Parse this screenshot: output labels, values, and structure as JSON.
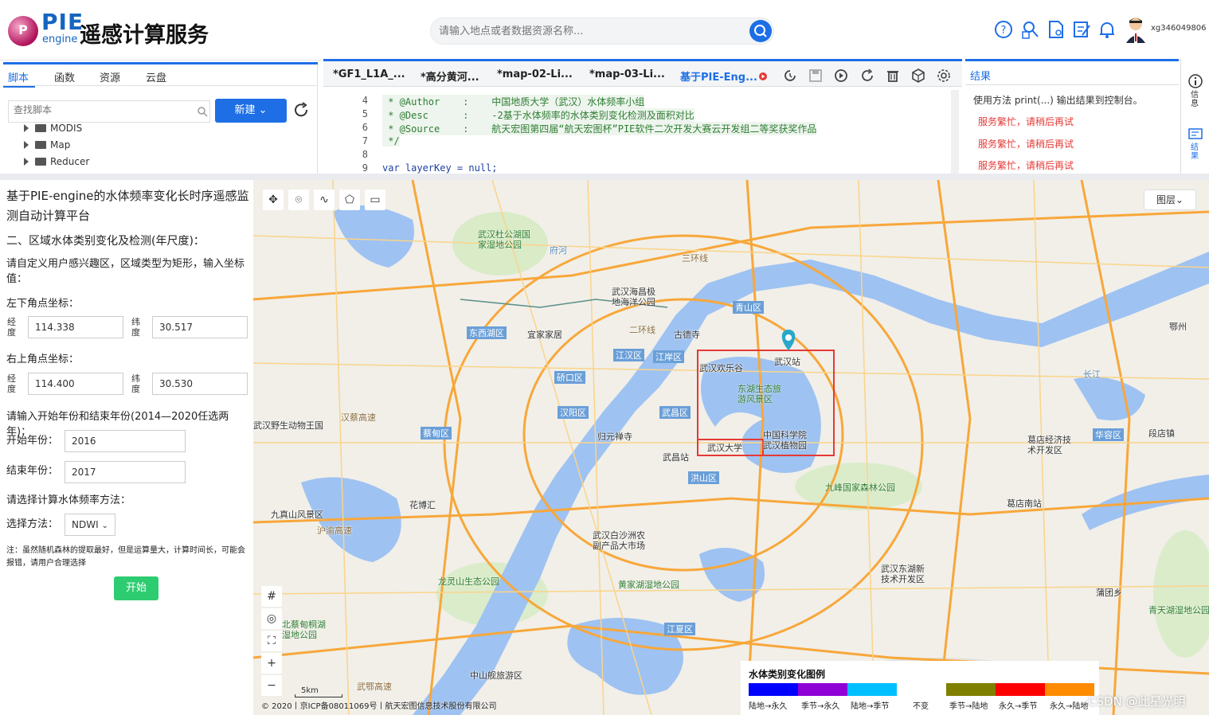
{
  "header": {
    "logo_pie": "PIE",
    "logo_engine": "engine",
    "logo_p": "P",
    "title": "遥感计算服务",
    "search_placeholder": "请输入地点或者数据资源名称...",
    "username": "xg346049806"
  },
  "script_panel": {
    "tabs": [
      "脚本",
      "函数",
      "资源",
      "云盘"
    ],
    "search_placeholder": "查找脚本",
    "new_button": "新建",
    "tree": [
      "MODIS",
      "Map",
      "Reducer"
    ]
  },
  "editor": {
    "tabs": [
      "*GF1_L1A_...",
      "*高分黄河...",
      "*map-02-Li...",
      "*map-03-Li...",
      "基于PIE-Eng..."
    ],
    "lines": [
      {
        "n": "4",
        "text": " * @Author    :    中国地质大学（武汉）水体频率小组"
      },
      {
        "n": "5",
        "text": " * @Desc      :    -2基于水体频率的水体类别变化检测及面积对比"
      },
      {
        "n": "6",
        "text": " * @Source    :    航天宏图第四届“航天宏图杯”PIE软件二次开发大赛云开发组二等奖获奖作品"
      },
      {
        "n": "7",
        "text": " */"
      },
      {
        "n": "8",
        "text": ""
      },
      {
        "n": "9",
        "text": "var layerKey = null;"
      }
    ]
  },
  "results": {
    "tab": "结果",
    "hint": "使用方法 print(...) 输出结果到控制台。",
    "errors": [
      "服务繁忙，请稍后再试",
      "服务繁忙，请稍后再试",
      "服务繁忙，请稍后再试"
    ],
    "rail": [
      "信息",
      "结果"
    ]
  },
  "form": {
    "title": "基于PIE-engine的水体频率变化长时序遥感监测自动计算平台",
    "section": "二、区域水体类别变化及检测(年尺度)：",
    "instruction": "请自定义用户感兴趣区，区域类型为矩形，输入坐标值：",
    "lower_left": "左下角点坐标：",
    "upper_right": "右上角点坐标：",
    "lon_label": "经度",
    "lat_label": "纬度",
    "ll_lon": "114.338",
    "ll_lat": "30.517",
    "ur_lon": "114.400",
    "ur_lat": "30.530",
    "year_prompt": "请输入开始年份和结束年份(2014—2020任选两年)：",
    "start_year_label": "开始年份：",
    "start_year": "2016",
    "end_year_label": "结束年份：",
    "end_year": "2017",
    "method_prompt": "请选择计算水体频率方法：",
    "method_label": "选择方法：",
    "method": "NDWI",
    "note": "注：虽然随机森林的提取最好，但是运算量大，计算时间长，可能会报错，请用户合理选择",
    "start_button": "开始"
  },
  "map": {
    "layers_button": "图层",
    "scale": "5km",
    "copyright": "© 2020丨京ICP备08011069号丨航天宏图信息技术股份有限公司",
    "watermark": "CSDN @此星光明",
    "legend_title": "水体类别变化图例",
    "legend": [
      {
        "label": "陆地→永久",
        "color": "#0000ff"
      },
      {
        "label": "季节→永久",
        "color": "#8e00d6"
      },
      {
        "label": "陆地→季节",
        "color": "#00bfff"
      },
      {
        "label": "不变",
        "color": "#ffffff"
      },
      {
        "label": "季节→陆地",
        "color": "#7f7f00"
      },
      {
        "label": "永久→季节",
        "color": "#ff0000"
      },
      {
        "label": "永久→陆地",
        "color": "#ff8c00"
      }
    ],
    "districts": [
      "东西湖区",
      "江汉区",
      "江岸区",
      "硚口区",
      "汉阳区",
      "武昌区",
      "洪山区",
      "青山区",
      "蔡甸区",
      "江夏区",
      "华容区"
    ],
    "places": [
      "武汉杜公湖国家湿地公园",
      "府河",
      "武汉海昌极地海洋公园",
      "古德寺",
      "宜家家居",
      "武汉欢乐谷",
      "武汉站",
      "东湖生态旅游风景区",
      "中国科学院武汉植物园",
      "武汉大学",
      "归元禅寺",
      "武昌站",
      "花博汇",
      "九真山风景区",
      "武汉白沙洲农副产品大市场",
      "龙灵山生态公园",
      "黄家湖湿地公园",
      "中山舰旅游区",
      "九峰国家森林公园",
      "葛店经济技术开发区",
      "葛店南站",
      "武汉东湖新技术开发区",
      "青天湖湿地公园",
      "武汉野生动物王国",
      "沪渝高速",
      "汉蔡高速",
      "三环线",
      "二环线",
      "长江",
      "北蔡甸桐湖湿地公园",
      "武鄂高速",
      "鄂州",
      "蒲团乡",
      "段店镇"
    ]
  }
}
